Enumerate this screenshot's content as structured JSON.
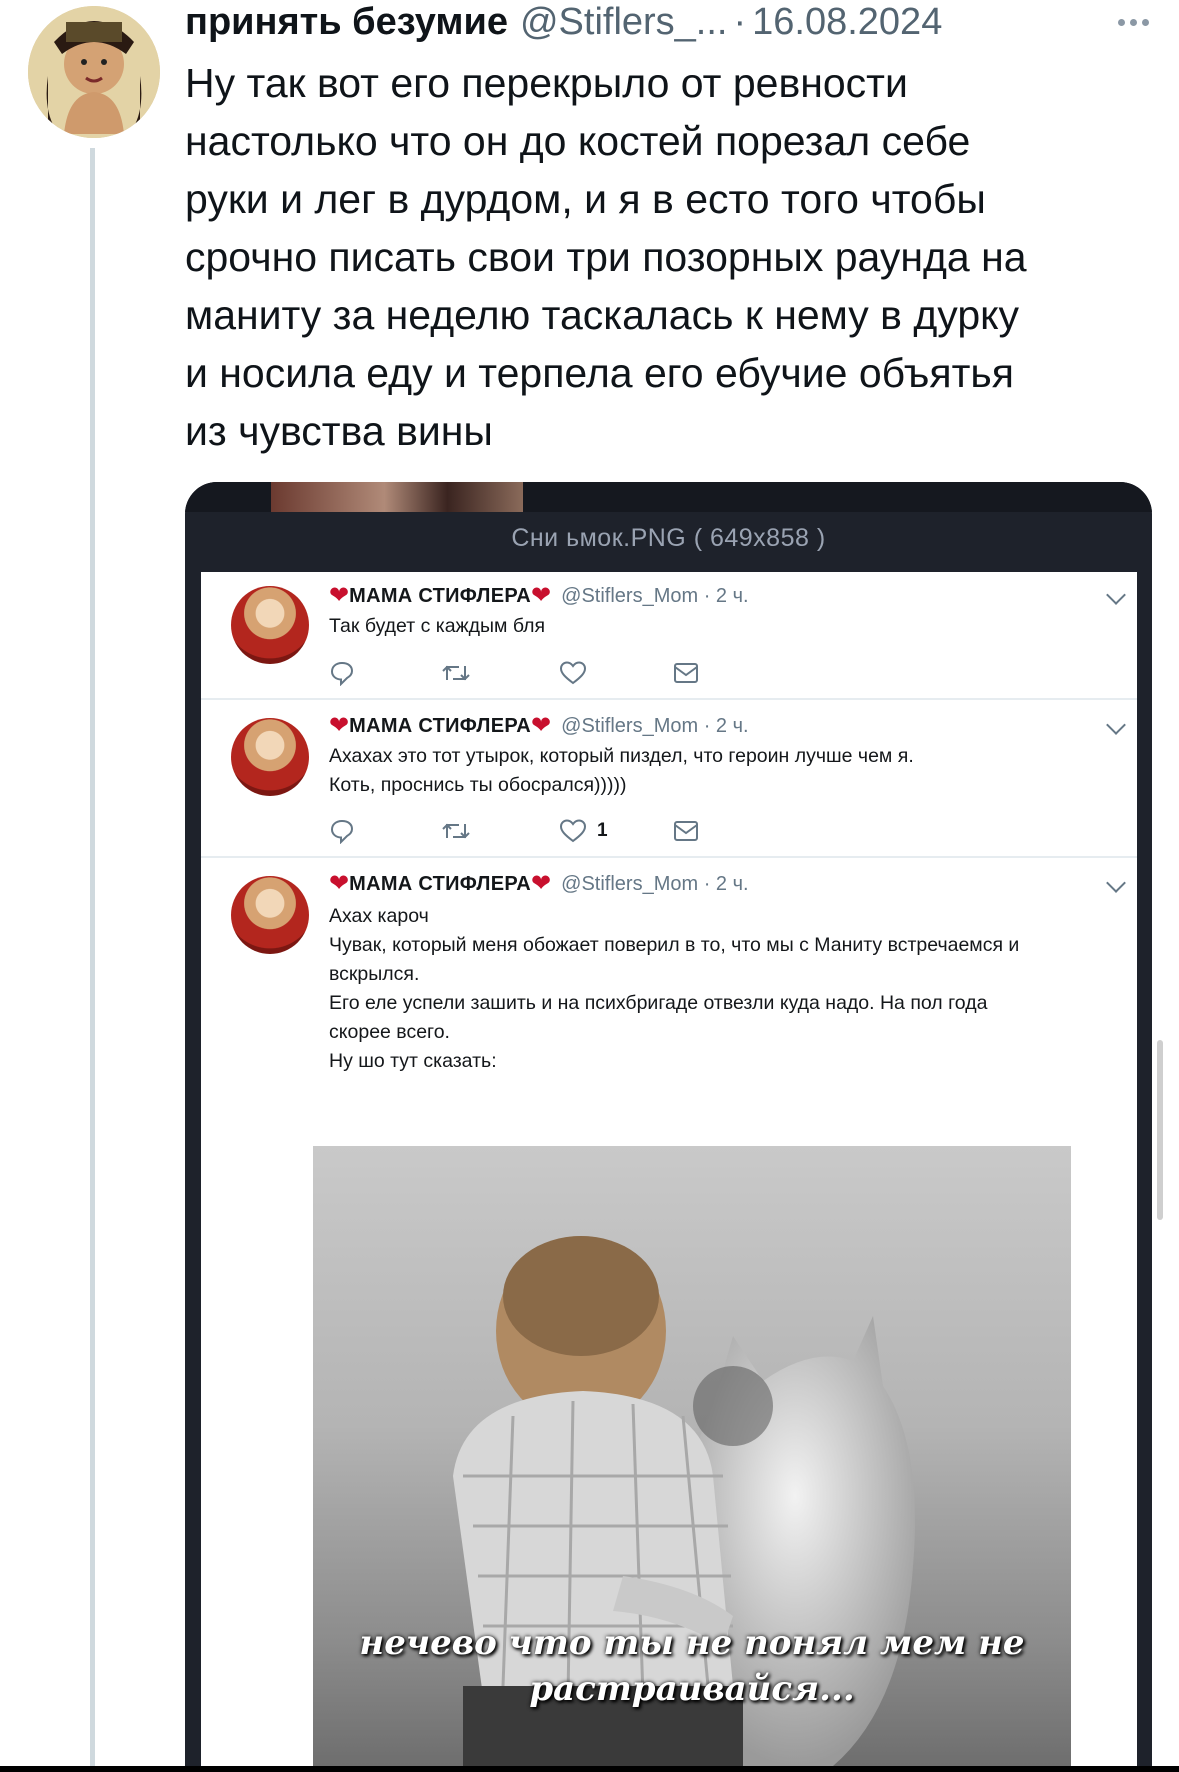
{
  "tweet": {
    "author_name": "принять безумие",
    "author_handle": "@Stiflers_...",
    "separator": "·",
    "date": "16.08.2024",
    "text_lines": [
      "Ну так вот его перекрыло от ревности",
      "настолько что он до костей порезал себе",
      "руки и лег в дурдом, и я в есто того чтобы",
      "срочно писать свои три позорных раунда на",
      "маниту за неделю таскалась к нему в дурку",
      "и носила еду и терпела его ебучие объятья",
      "из чувства вины"
    ]
  },
  "media": {
    "file_title": "Сни ьмок.PNG ( 649x858 )",
    "inner_tweets": [
      {
        "name": "МАМА СТИФЛЕРА",
        "meta": "@Stiflers_Mom · 2 ч.",
        "lines": [
          "Так будет с каждым бля"
        ],
        "like_count": ""
      },
      {
        "name": "МАМА СТИФЛЕРА",
        "meta": "@Stiflers_Mom · 2 ч.",
        "lines": [
          "Ахахах это тот утырок, который пиздел, что героин лучше чем я.",
          "Коть, проснись ты обосрался)))))"
        ],
        "like_count": "1"
      },
      {
        "name": "МАМА СТИФЛЕРА",
        "meta": "@Stiflers_Mom · 2 ч.",
        "lines": [
          "Ахах кароч",
          "Чувак, который меня обожает поверил в то, что мы с Маниту встречаемся и",
          "вскрылся.",
          "Его еле успели зашить и на психбригаде отвезли куда надо. На пол года",
          "скорее всего.",
          "Ну шо тут сказать:"
        ],
        "like_count": ""
      }
    ],
    "meme_caption": [
      "нечево что ты не понял мем не",
      "растраивайся..."
    ]
  },
  "icons": [
    "more-icon",
    "heart-icon",
    "chevron-down-icon",
    "reply-icon",
    "retweet-icon",
    "like-icon",
    "message-icon"
  ],
  "colors": {
    "accent_heart": "#c8102e",
    "secondary_text": "#536471",
    "thread_line": "#cfd9de"
  }
}
